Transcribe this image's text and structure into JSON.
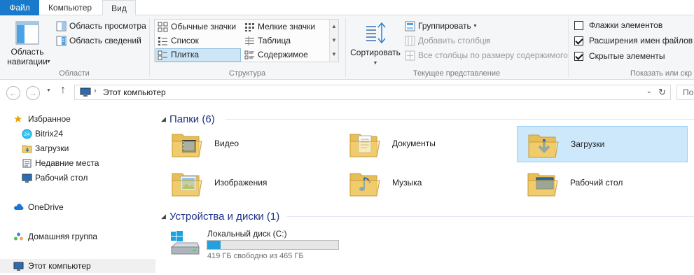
{
  "tabs": {
    "file": "Файл",
    "computer": "Компьютер",
    "view": "Вид"
  },
  "ribbon": {
    "panes": {
      "label": "Области",
      "nav_pane": "Область\nнавигации",
      "preview_pane": "Область просмотра",
      "details_pane": "Область сведений"
    },
    "layout": {
      "label": "Структура",
      "items": [
        "Обычные значки",
        "Мелкие значки",
        "Список",
        "Таблица",
        "Плитка",
        "Содержимое"
      ],
      "selected": "Плитка"
    },
    "current_view": {
      "label": "Текущее представление",
      "sort": "Сортировать",
      "group_by": "Группировать",
      "add_columns": "Добавить столбцы",
      "fit_columns": "Все столбцы по размеру содержимого"
    },
    "show_hide": {
      "label": "Показать или скр",
      "item_checkboxes": "Флажки элементов",
      "file_extensions": "Расширения имен файлов",
      "hidden_items": "Скрытые элементы",
      "item_checkboxes_checked": false,
      "file_extensions_checked": true,
      "hidden_items_checked": true
    }
  },
  "address": {
    "path": "Этот компьютер",
    "search_placeholder": "По"
  },
  "navpane": {
    "favorites": "Избранное",
    "fav_items": [
      "Bitrix24",
      "Загрузки",
      "Недавние места",
      "Рабочий стол"
    ],
    "onedrive": "OneDrive",
    "homegroup": "Домашняя группа",
    "this_pc": "Этот компьютер"
  },
  "content": {
    "folders_header": "Папки (6)",
    "folders": [
      "Видео",
      "Документы",
      "Загрузки",
      "Изображения",
      "Музыка",
      "Рабочий стол"
    ],
    "selected_folder": "Загрузки",
    "drives_header": "Устройства и диски (1)",
    "drive": {
      "name": "Локальный диск (C:)",
      "free_text": "419 ГБ свободно из 465 ГБ",
      "used_fraction": 0.099
    }
  },
  "colors": {
    "accent": "#1979ca",
    "selection": "#cde8fb",
    "header_text": "#1e3287",
    "drive_bar": "#26a0da"
  }
}
